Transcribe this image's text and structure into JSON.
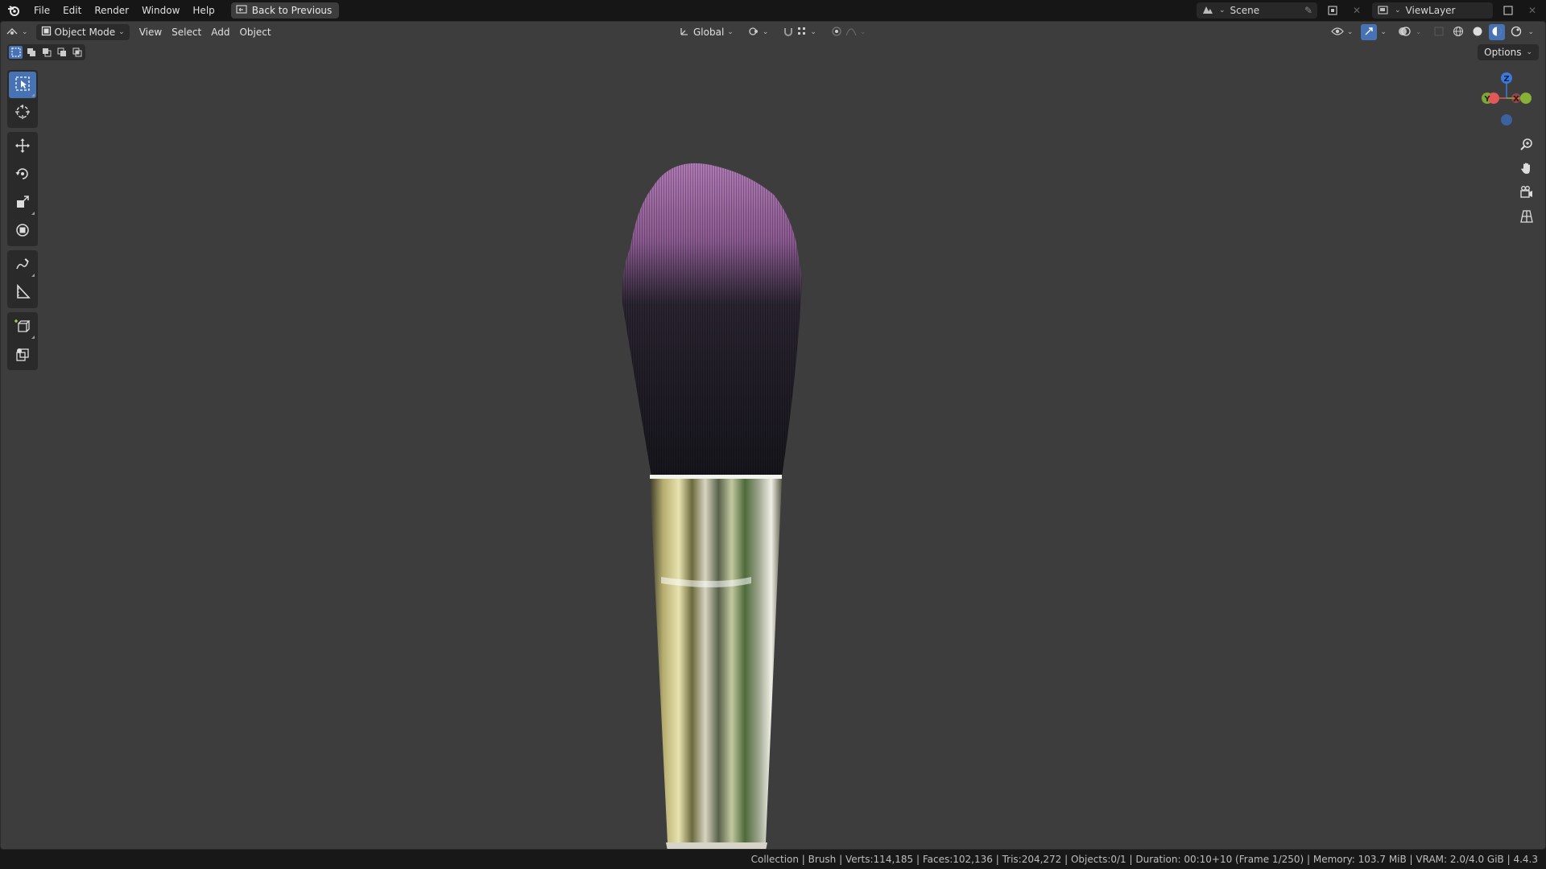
{
  "menu": {
    "items": [
      "File",
      "Edit",
      "Render",
      "Window",
      "Help"
    ],
    "back_button": "Back to Previous"
  },
  "topbar_right": {
    "scene": "Scene",
    "view_layer": "ViewLayer"
  },
  "viewport_header": {
    "mode": "Object Mode",
    "menus": [
      "View",
      "Select",
      "Add",
      "Object"
    ],
    "transform_orientation": "Global",
    "options": "Options"
  },
  "toolbar": {
    "tools": [
      "select-box",
      "cursor",
      "move",
      "rotate",
      "scale",
      "transform",
      "annotate",
      "measure",
      "add-cube",
      "add-object"
    ]
  },
  "gizmo": {
    "axes": {
      "z": "Z",
      "y": "Y",
      "x": "X"
    },
    "colors": {
      "x": "#e05858",
      "y": "#86b335",
      "z": "#3a7be0"
    }
  },
  "status": {
    "text": "Collection | Brush | Verts:114,185 | Faces:102,136 | Tris:204,272 | Objects:0/1 | Duration: 00:10+10 (Frame 1/250) | Memory: 103.7 MiB | VRAM: 2.0/4.0 GiB | 4.4.3"
  },
  "colors": {
    "accent": "#4772b3",
    "viewport_bg": "#3d3d3d",
    "bristle_tip": "#9a6aa0",
    "bristle_base": "#15151c"
  }
}
